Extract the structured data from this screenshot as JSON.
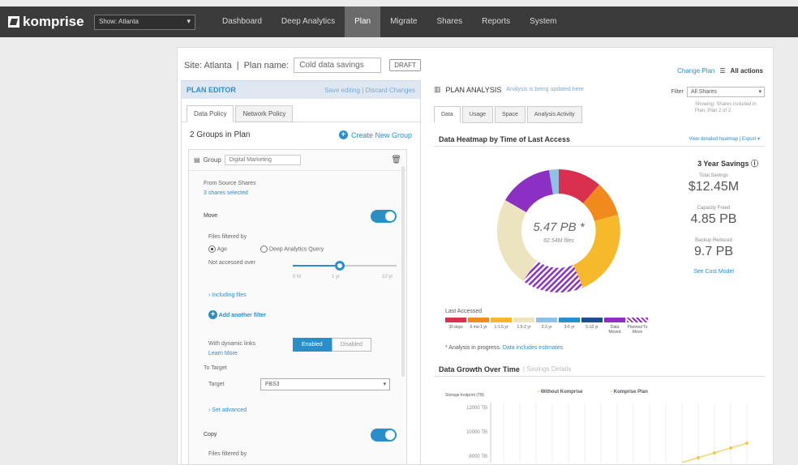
{
  "app": {
    "logo_text": "komprise"
  },
  "site_selector": {
    "value": "Show: Atlanta",
    "caret": "▾"
  },
  "nav": {
    "items": [
      {
        "label": "Dashboard",
        "active": false
      },
      {
        "label": "Deep Analytics",
        "active": false
      },
      {
        "label": "Plan",
        "active": true
      },
      {
        "label": "Migrate",
        "active": false
      },
      {
        "label": "Shares",
        "active": false
      },
      {
        "label": "Reports",
        "active": false
      },
      {
        "label": "System",
        "active": false
      }
    ]
  },
  "plan_header": {
    "site_label": "Site: Atlanta",
    "separator": "|",
    "plan_name_label": "Plan name:",
    "plan_name_value": "Cold data savings",
    "status_badge": "DRAFT",
    "change_plan_link": "Change Plan",
    "all_actions": "All actions"
  },
  "editor": {
    "title": "PLAN EDITOR",
    "right_links": "Save editing | Discard Changes",
    "tabs": [
      {
        "label": "Data Policy",
        "active": true
      },
      {
        "label": "Network Policy",
        "active": false
      }
    ],
    "groups_count": "2 Groups in Plan",
    "create_group": "Create New Group",
    "group": {
      "label": "Group",
      "name": "Digital Marketing",
      "from_source_label": "From Source Shares",
      "sources_selected": "3 shares selected",
      "move_label": "Move",
      "toggle_label": "ON",
      "files_filtered_by": "Files filtered by",
      "option_age": "Age",
      "option_query": "Deep Analytics Query",
      "not_accessed": "Not accessed over",
      "slider_ticks": [
        "0 M",
        "1 yr",
        "10 yr"
      ],
      "including_files": "Including files",
      "add_filter": "Add another filter",
      "dynamic_links_label": "With dynamic links",
      "learn_more": "Learn More",
      "enabled": "Enabled",
      "disabled": "Disabled",
      "to_target": "To Target",
      "target_label": "Target",
      "target_value": "FBS3",
      "set_advanced": "Set advanced",
      "copy_label": "Copy",
      "copy_toggle": "ON",
      "copy_files_filtered": "Files filtered by"
    }
  },
  "analysis": {
    "title": "PLAN ANALYSIS",
    "subtitle_link": "Analysis is being updated here",
    "filter_label": "Filter",
    "filter_value": "All Shares",
    "filter_note": "Showing: Shares included in Plan, Plan 2 of 2",
    "tabs": [
      {
        "label": "Data",
        "active": true
      },
      {
        "label": "Usage",
        "active": false
      },
      {
        "label": "Space",
        "active": false
      },
      {
        "label": "Analysis Activity",
        "active": false
      }
    ],
    "heatmap_title": "Data Heatmap by Time of Last Access",
    "heatmap_links": "View detailed heatmap | Export ▾",
    "donut_center_value": "5.47 PB *",
    "donut_center_sub": "62.54M files",
    "savings_title": "3 Year Savings",
    "savings": [
      {
        "label": "Total Savings",
        "value": "$12.45M"
      },
      {
        "label": "Capacity Freed",
        "value": "4.85 PB"
      },
      {
        "label": "Backup Reduced",
        "value": "9.7 PB"
      }
    ],
    "see_cost_model": "See Cost Model",
    "legend_title": "Last Accessed",
    "legend": [
      {
        "label": "30 days",
        "color": "#d9304f"
      },
      {
        "label": "6 mo-1 yr",
        "color": "#f18a1c"
      },
      {
        "label": "1-1.5 yr",
        "color": "#f5b92b"
      },
      {
        "label": "1.5-2 yr",
        "color": "#ece4bf"
      },
      {
        "label": "2-3 yr",
        "color": "#8fc3e6"
      },
      {
        "label": "3-5 yr",
        "color": "#2a8fc9"
      },
      {
        "label": "5-10 yr",
        "color": "#1f4f86"
      },
      {
        "label": "Data Moved",
        "color": "#8c2fc3"
      },
      {
        "label": "Planned To Move",
        "color": "#b76ed9"
      }
    ],
    "analysis_note_prefix": "* Analysis in progress.",
    "analysis_note_link": "Data includes estimates",
    "growth_title": "Data Growth Over Time",
    "growth_sub": "| Savings Details",
    "growth_ylabel": "Storage footprint (TB)",
    "growth_series": [
      "Without Komprise",
      "Komprise Plan"
    ],
    "growth_ticks": [
      "12000 TB",
      "10000 TB",
      "8000 TB"
    ]
  }
}
